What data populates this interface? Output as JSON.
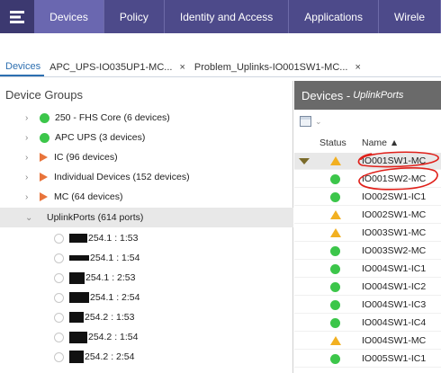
{
  "nav": {
    "tabs": [
      {
        "label": "Devices"
      },
      {
        "label": "Policy"
      },
      {
        "label": "Identity and Access"
      },
      {
        "label": "Applications"
      },
      {
        "label": "Wirele"
      }
    ]
  },
  "page_tabs": [
    {
      "label": "Devices"
    },
    {
      "label": "APC_UPS-IO035UP1-MC...",
      "close": "×"
    },
    {
      "label": "Problem_Uplinks-IO001SW1-MC...",
      "close": "×"
    }
  ],
  "left": {
    "title": "Device Groups",
    "groups": [
      {
        "label": "250 - FHS Core (6 devices)",
        "icon": "green-dot"
      },
      {
        "label": "APC UPS (3 devices)",
        "icon": "green-dot"
      },
      {
        "label": "IC (96 devices)",
        "icon": "orange-triangle"
      },
      {
        "label": "Individual Devices (152 devices)",
        "icon": "orange-triangle"
      },
      {
        "label": "MC (64 devices)",
        "icon": "orange-triangle"
      },
      {
        "label": "UplinkPorts (614 ports)",
        "icon": "none"
      }
    ],
    "ports": [
      {
        "label": "254.1 : 1:53"
      },
      {
        "label": "254.1 : 1:54"
      },
      {
        "label": "254.1 : 2:53"
      },
      {
        "label": "254.1 : 2:54"
      },
      {
        "label": "254.2 : 1:53"
      },
      {
        "label": "254.2 : 1:54"
      },
      {
        "label": "254.2 : 2:54"
      }
    ]
  },
  "right": {
    "title": "Devices - ",
    "subtitle": "UplinkPorts",
    "columns": {
      "status": "Status",
      "name": "Name ▲"
    },
    "rows": [
      {
        "name": "IO001SW1-MC",
        "status": "warning"
      },
      {
        "name": "IO001SW2-MC",
        "status": "up"
      },
      {
        "name": "IO002SW1-IC1",
        "status": "up"
      },
      {
        "name": "IO002SW1-MC",
        "status": "warning"
      },
      {
        "name": "IO003SW1-MC",
        "status": "warning"
      },
      {
        "name": "IO003SW2-MC",
        "status": "up"
      },
      {
        "name": "IO004SW1-IC1",
        "status": "up"
      },
      {
        "name": "IO004SW1-IC2",
        "status": "up"
      },
      {
        "name": "IO004SW1-IC3",
        "status": "up"
      },
      {
        "name": "IO004SW1-IC4",
        "status": "up"
      },
      {
        "name": "IO004SW1-MC",
        "status": "warning"
      },
      {
        "name": "IO005SW1-IC1",
        "status": "up"
      }
    ]
  },
  "colors": {
    "nav_bg": "#4d4a8a",
    "nav_active": "#6a67b0",
    "green": "#3cc64a",
    "orange": "#e8743b",
    "amber": "#f2b021",
    "annotation": "#e0201a"
  }
}
